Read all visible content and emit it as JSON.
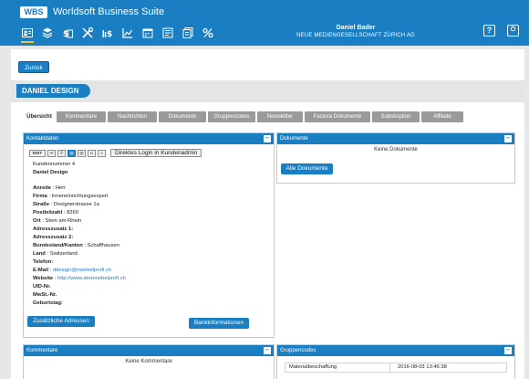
{
  "app": {
    "logo": "WBS",
    "title": "Worldsoft Business Suite"
  },
  "user": {
    "name": "Daniel Bader",
    "company": "NEUE MEDIENGESELLSCHAFT ZÜRICH AG"
  },
  "top_buttons": {
    "help": "?",
    "power": "⏻"
  },
  "nav_icons": [
    "contacts-icon",
    "tasks-icon",
    "money-icon",
    "tools-icon",
    "dollar-icon",
    "chart-icon",
    "calendar-icon",
    "list-icon",
    "documents-icon",
    "percent-icon"
  ],
  "back_label": "Zurück",
  "customer_title": "DANIEL DESIGN",
  "tabs": [
    "Übersicht",
    "Kommentare",
    "Nachrichten",
    "Dokumente",
    "Gruppencodes",
    "Newsletter",
    "Factura Dokumente",
    "Subskription",
    "Affiliate"
  ],
  "kontaktdaten": {
    "header": "Kontaktdaten",
    "toolbar": {
      "edit": "EDIT",
      "login_label": "Direktes Login in Kundenadmin"
    },
    "kundennummer": "Kundennummer 4",
    "company_name": "Daniel Design",
    "fields": [
      {
        "label": "Anrede",
        "value": "Herr"
      },
      {
        "label": "Firma",
        "value": "Inneneinrichtungsexpert"
      },
      {
        "label": "Straße",
        "value": "Designerstrasse 1a"
      },
      {
        "label": "Postleitzahl",
        "value": "8260"
      },
      {
        "label": "Ort",
        "value": "Stein am Rhein"
      },
      {
        "label": "Adresszusatz 1",
        "value": ""
      },
      {
        "label": "Adresszusatz 2",
        "value": ""
      },
      {
        "label": "Bundesland/Kanton",
        "value": "Schaffhausen"
      },
      {
        "label": "Land",
        "value": "Switzerland"
      },
      {
        "label": "Telefon",
        "value": ""
      },
      {
        "label": "E-Mail",
        "value": "ddesign@moebelprofi.ch"
      },
      {
        "label": "Website",
        "value": "http://www.dermoebelprofi.ch"
      },
      {
        "label": "UID-Nr.",
        "value": ""
      },
      {
        "label": "MwSt.-Nr.",
        "value": ""
      },
      {
        "label": "Geburtstag",
        "value": ""
      }
    ],
    "btn_addresses": "Zusätzliche Adressen",
    "btn_bank": "Bankinformationen"
  },
  "dokumente": {
    "header": "Dokumente",
    "empty": "Keine Dokumente",
    "btn_all": "Alle Dokumente"
  },
  "kommentare": {
    "header": "Kommentare",
    "empty": "Keine Kommentare"
  },
  "gruppencodes": {
    "header": "Gruppencodes",
    "rows": [
      {
        "name": "Materialbeschaffung",
        "date": "2016-08-03 13:46:38"
      }
    ]
  }
}
